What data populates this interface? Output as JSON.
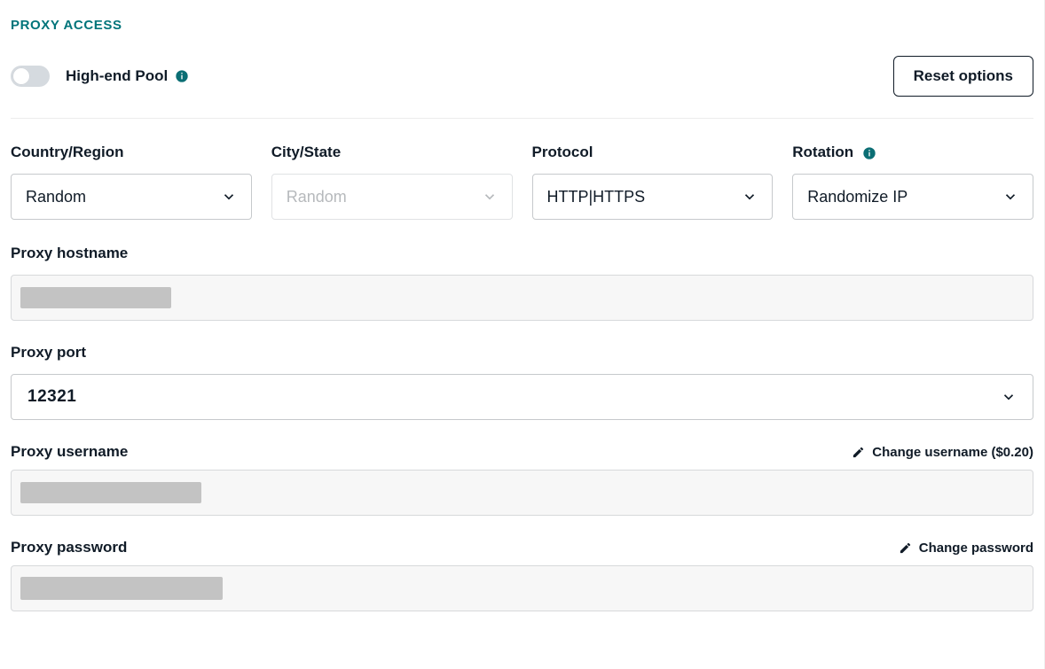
{
  "section_title": "PROXY ACCESS",
  "high_end_pool": {
    "label": "High-end Pool"
  },
  "reset_button": "Reset options",
  "fields": {
    "country": {
      "label": "Country/Region",
      "value": "Random"
    },
    "city": {
      "label": "City/State",
      "placeholder": "Random"
    },
    "protocol": {
      "label": "Protocol",
      "value": "HTTP|HTTPS"
    },
    "rotation": {
      "label": "Rotation",
      "value": "Randomize IP"
    }
  },
  "hostname": {
    "label": "Proxy hostname"
  },
  "port": {
    "label": "Proxy port",
    "value": "12321"
  },
  "username": {
    "label": "Proxy username",
    "action": "Change username ($0.20)"
  },
  "password": {
    "label": "Proxy password",
    "action": "Change password"
  }
}
